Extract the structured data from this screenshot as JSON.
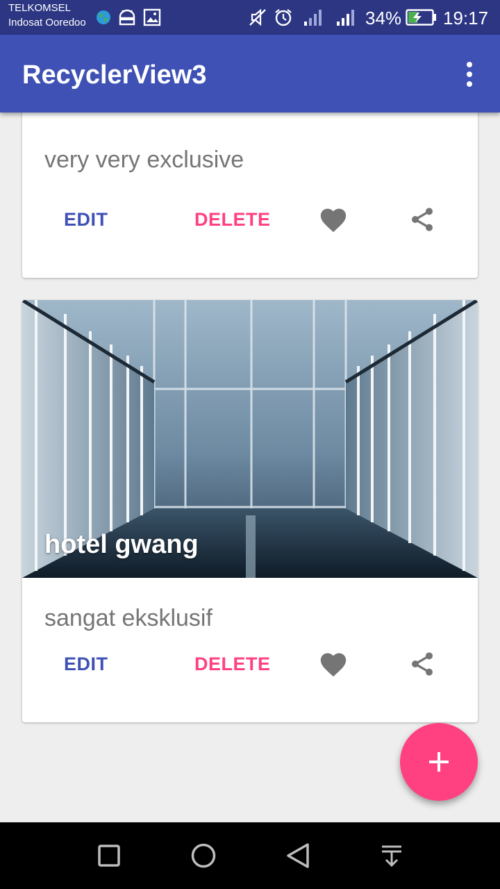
{
  "status_bar": {
    "carrier_1": "TELKOMSEL",
    "carrier_2": "Indosat Ooredoo",
    "battery_percent": "34%",
    "time": "19:17",
    "icons": [
      "globe-icon",
      "android-icon",
      "image-icon",
      "vibrate-off-icon",
      "alarm-icon",
      "signal-icon",
      "signal-icon",
      "battery-charging-icon"
    ]
  },
  "app_bar": {
    "title": "RecyclerView3",
    "menu_icon": "overflow-menu-icon"
  },
  "cards": [
    {
      "description": "very very exclusive",
      "edit_label": "EDIT",
      "delete_label": "DELETE"
    },
    {
      "title": "hotel gwang",
      "description": "sangat eksklusif",
      "edit_label": "EDIT",
      "delete_label": "DELETE"
    }
  ],
  "colors": {
    "primary": "#3f51b5",
    "primary_dark": "#2c3683",
    "accent": "#ff4081",
    "text_secondary": "#757575"
  },
  "fab": {
    "icon": "plus-icon"
  },
  "nav_bar": {
    "icons": [
      "recents-icon",
      "home-icon",
      "back-icon",
      "notification-pull-icon"
    ]
  }
}
